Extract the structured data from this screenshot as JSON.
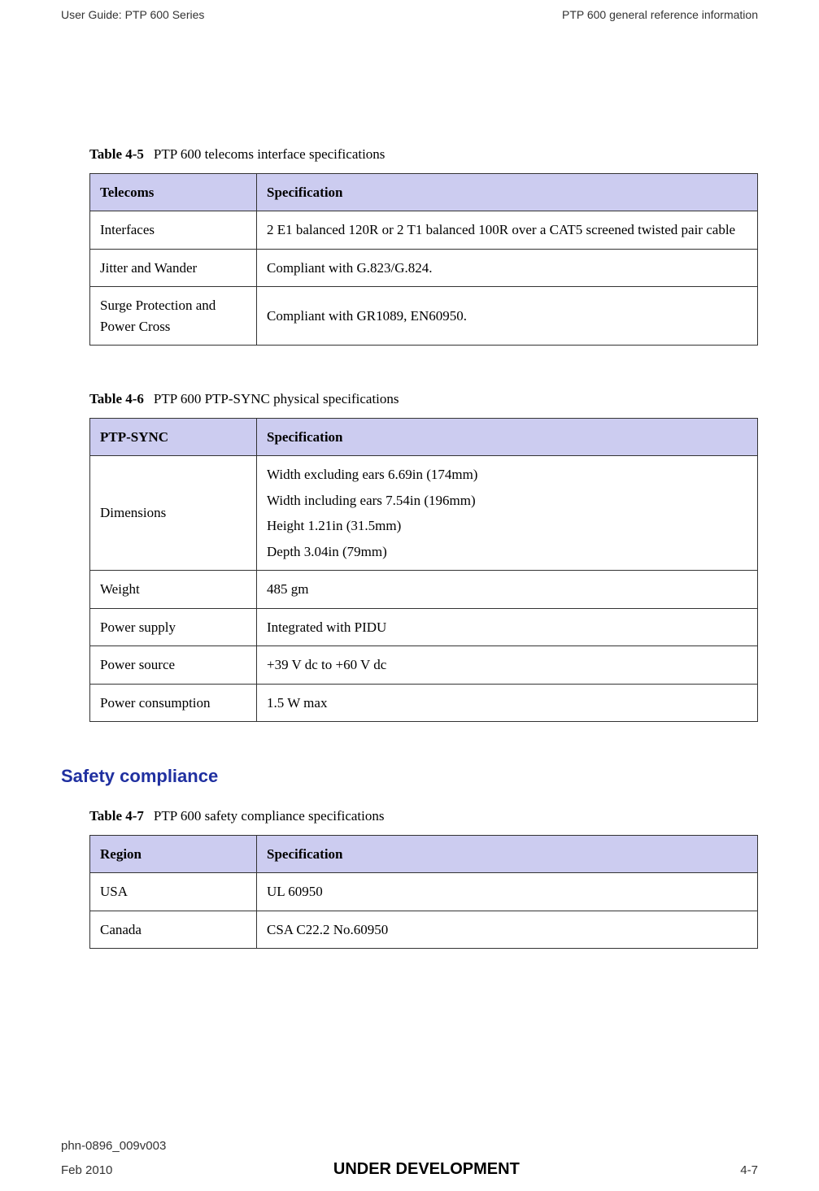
{
  "header": {
    "left": "User Guide: PTP 600 Series",
    "right": "PTP 600 general reference information"
  },
  "table45": {
    "caption_label": "Table 4-5",
    "caption_text": "PTP 600 telecoms interface specifications",
    "header_col1": "Telecoms",
    "header_col2": "Specification",
    "rows": [
      {
        "c1": "Interfaces",
        "c2": "2 E1 balanced 120R or 2 T1 balanced 100R over a CAT5 screened twisted pair cable"
      },
      {
        "c1": "Jitter and Wander",
        "c2": "Compliant with G.823/G.824."
      },
      {
        "c1": "Surge Protection and Power Cross",
        "c2": "Compliant with GR1089, EN60950."
      }
    ]
  },
  "table46": {
    "caption_label": "Table 4-6",
    "caption_text": "PTP 600 PTP-SYNC physical specifications",
    "header_col1": "PTP-SYNC",
    "header_col2": "Specification",
    "rows_dims": {
      "c1": "Dimensions",
      "lines": [
        "Width excluding ears 6.69in (174mm)",
        "Width including ears  7.54in (196mm)",
        "Height 1.21in (31.5mm)",
        "Depth 3.04in (79mm)"
      ]
    },
    "rows": [
      {
        "c1": "Weight",
        "c2": "485 gm"
      },
      {
        "c1": "Power supply",
        "c2": "Integrated with PIDU"
      },
      {
        "c1": "Power source",
        "c2": "+39 V dc to +60 V dc"
      },
      {
        "c1": "Power consumption",
        "c2": "1.5 W max"
      }
    ]
  },
  "section_heading": "Safety compliance",
  "table47": {
    "caption_label": "Table 4-7",
    "caption_text": "PTP 600 safety compliance specifications",
    "header_col1": "Region",
    "header_col2": "Specification",
    "rows": [
      {
        "c1": "USA",
        "c2": "UL 60950"
      },
      {
        "c1": "Canada",
        "c2": "CSA C22.2 No.60950"
      }
    ]
  },
  "footer": {
    "doc_id": "phn-0896_009v003",
    "date": "Feb 2010",
    "center": "UNDER DEVELOPMENT",
    "page": "4-7"
  }
}
